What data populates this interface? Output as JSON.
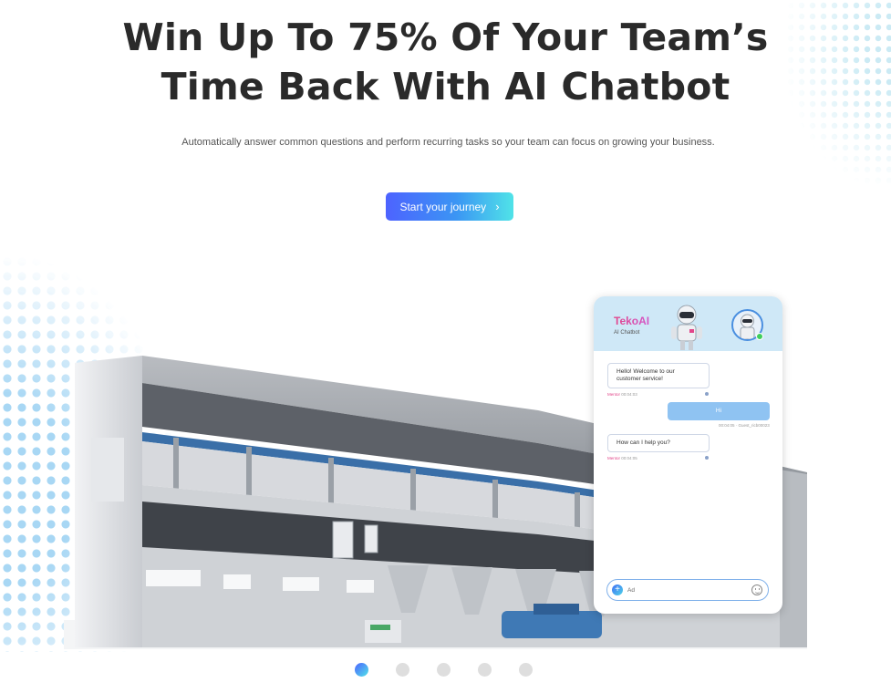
{
  "hero": {
    "title_line1": "Win Up To 75% Of Your Team’s",
    "title_line2": "Time Back With AI Chatbot",
    "subtitle": "Automatically answer common questions and perform recurring tasks so your team can focus on growing your business.",
    "cta_label": "Start your journey",
    "cta_icon": "chevron-right-icon"
  },
  "chatbot": {
    "brand": "TekoAI",
    "brand_sub": "AI Chatbot",
    "messages": [
      {
        "from": "bot",
        "text": "Hello! Welcome to our customer service!",
        "sender": "Mentor",
        "time": "00:04:03"
      },
      {
        "from": "user",
        "text": "Hi",
        "time": "00:04:05",
        "sender": "Guest_ricb00023"
      },
      {
        "from": "bot",
        "text": "How can I help you?",
        "sender": "Mentor",
        "time": "00:04:05"
      }
    ],
    "input_value": "Ad",
    "colors": {
      "brand": "#e2468a",
      "online": "#3fce5b",
      "user_bubble": "#8fc3f2"
    }
  },
  "carousel": {
    "slides": [
      "slide-1",
      "slide-2",
      "slide-3",
      "slide-4",
      "slide-5"
    ],
    "active_index": 0
  },
  "colors": {
    "accent_start": "#4d63ff",
    "accent_end": "#50e3e8",
    "heading": "#2a2a2a"
  }
}
